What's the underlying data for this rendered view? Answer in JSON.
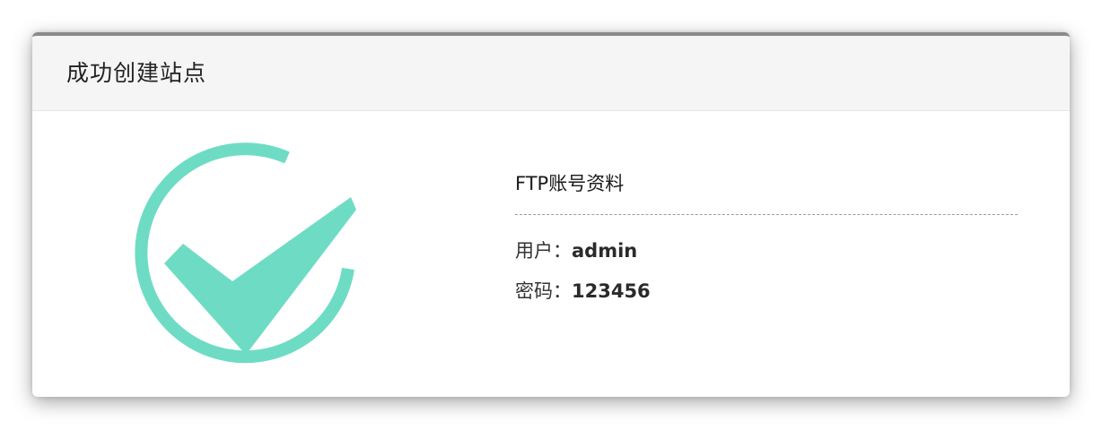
{
  "dialog": {
    "title": "成功创建站点"
  },
  "icon": {
    "name": "success-check-icon",
    "color": "#6edcc4"
  },
  "ftp_info": {
    "heading": "FTP账号资料",
    "user_label": "用户：",
    "user_value": "admin",
    "password_label": "密码：",
    "password_value": "123456"
  }
}
